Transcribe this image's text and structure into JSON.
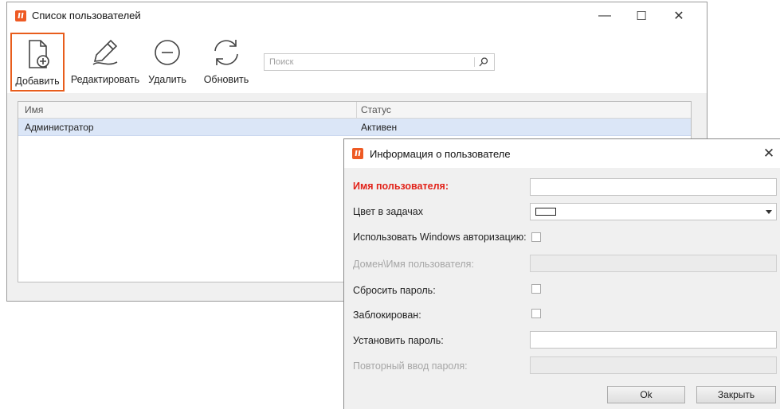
{
  "main_window": {
    "title": "Список пользователей",
    "controls": {
      "minimize": "—",
      "maximize": "☐",
      "close": "✕"
    },
    "toolbar": {
      "add": "Добавить",
      "edit": "Редактировать",
      "delete": "Удалить",
      "refresh": "Обновить"
    },
    "search": {
      "placeholder": "Поиск"
    },
    "grid": {
      "columns": [
        "Имя",
        "Статус"
      ],
      "rows": [
        {
          "name": "Администратор",
          "status": "Активен"
        }
      ]
    }
  },
  "dialog": {
    "title": "Информация о пользователе",
    "close": "✕",
    "fields": {
      "username": "Имя пользователя:",
      "task_color": "Цвет в задачах",
      "use_windows_auth": "Использовать Windows авторизацию:",
      "domain_user": "Домен\\Имя пользователя:",
      "reset_password": "Сбросить пароль:",
      "blocked": "Заблокирован:",
      "set_password": "Установить пароль:",
      "repeat_password": "Повторный ввод пароля:"
    },
    "buttons": {
      "ok": "Ok",
      "close": "Закрыть"
    }
  },
  "colors": {
    "accent": "#e85d1c",
    "required_label": "#e2231a",
    "selected_row": "#dbe6f7"
  }
}
